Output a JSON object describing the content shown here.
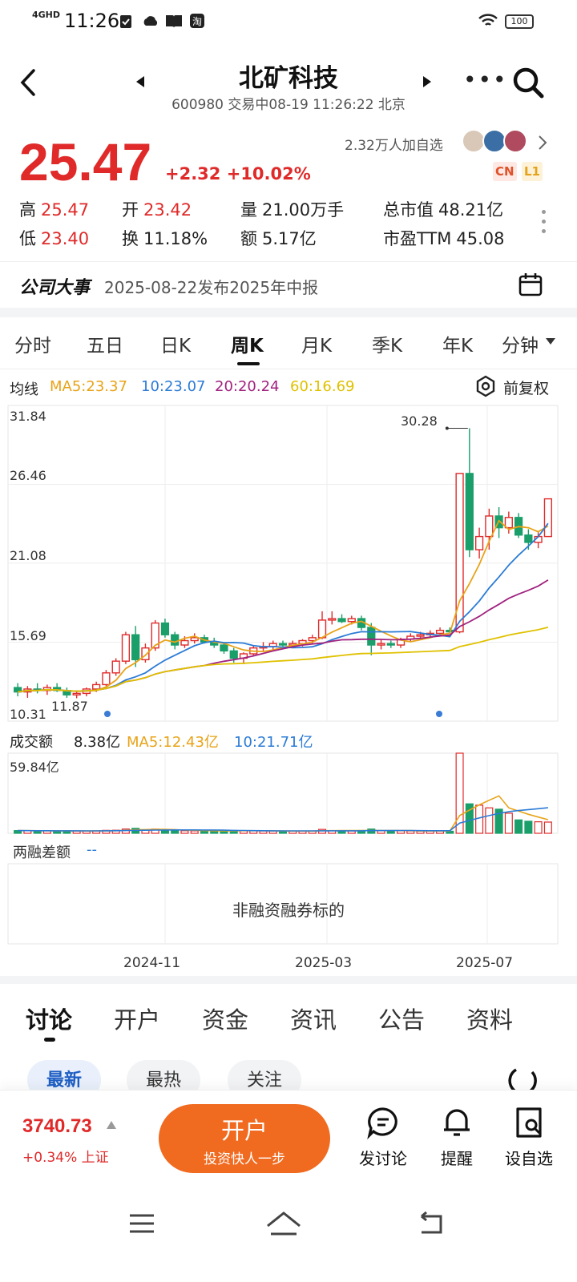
{
  "status_bar": {
    "time": "11:26",
    "network": "4GHD",
    "battery": "100"
  },
  "header": {
    "title": "北矿科技",
    "subtitle": "600980 交易中08-19 11:26:22 北京"
  },
  "quote": {
    "price": "25.47",
    "change": "+2.32 +10.02%",
    "watchers": "2.32万人加自选",
    "badges": [
      "CN",
      "L1"
    ]
  },
  "stats": [
    {
      "label": "高",
      "value": "25.47",
      "color": "red"
    },
    {
      "label": "开",
      "value": "23.42",
      "color": "red"
    },
    {
      "label": "量",
      "value": "21.00万手",
      "color": "plain"
    },
    {
      "label": "总市值",
      "value": "48.21亿",
      "color": "plain"
    },
    {
      "label": "低",
      "value": "23.40",
      "color": "red"
    },
    {
      "label": "换",
      "value": "11.18%",
      "color": "plain"
    },
    {
      "label": "额",
      "value": "5.17亿",
      "color": "plain"
    },
    {
      "label": "市盈TTM",
      "value": "45.08",
      "color": "plain"
    }
  ],
  "events": {
    "label": "公司大事",
    "text": "2025-08-22发布2025年中报"
  },
  "period_tabs": [
    "分时",
    "五日",
    "日K",
    "周K",
    "月K",
    "季K",
    "年K",
    "分钟"
  ],
  "active_period": "周K",
  "ma_legend": {
    "label": "均线",
    "items": [
      {
        "text": "MA5:23.37",
        "color": "#e8a317"
      },
      {
        "text": "10:23.07",
        "color": "#2b7bd6"
      },
      {
        "text": "20:20.24",
        "color": "#a0227f"
      },
      {
        "text": "60:16.69",
        "color": "#e0c100"
      }
    ],
    "adjust": "前复权"
  },
  "price_axis": [
    "31.84",
    "26.46",
    "21.08",
    "15.69",
    "10.31"
  ],
  "annotations": {
    "high": "30.28",
    "low": "11.87"
  },
  "volume": {
    "label": "成交额",
    "current": "8.38亿",
    "ma5": "MA5:12.43亿",
    "ma10": "10:21.71亿",
    "axis_max": "59.84亿"
  },
  "margin": {
    "label": "两融差额",
    "value": "--",
    "note": "非融资融券标的"
  },
  "date_axis": [
    "2024-11",
    "2025-03",
    "2025-07"
  ],
  "colors": {
    "up": "#e02a2a",
    "down": "#1a9e6a",
    "accent": "#f06a1f"
  },
  "chart_data": {
    "type": "candlestick",
    "period": "weekly",
    "ylim": [
      10.31,
      31.84
    ],
    "x": [
      "2024-07 wk1",
      "wk2",
      "wk3",
      "wk4",
      "wk5",
      "wk6",
      "wk7",
      "wk8",
      "wk9",
      "wk10",
      "wk11",
      "wk12",
      "wk13",
      "2024-11 wk1",
      "wk2",
      "wk3",
      "wk4",
      "wk5",
      "wk6",
      "wk7",
      "wk8",
      "wk9",
      "wk10",
      "wk11",
      "wk12",
      "wk13",
      "wk14",
      "wk15",
      "wk16",
      "wk17",
      "wk18",
      "wk19",
      "wk20",
      "wk21",
      "wk22",
      "2025-03 wk1",
      "wk2",
      "wk3",
      "wk4",
      "wk5",
      "wk6",
      "wk7",
      "wk8",
      "wk9",
      "wk10",
      "wk11",
      "wk12",
      "wk13",
      "wk14",
      "wk15",
      "wk16",
      "wk17",
      "wk18",
      "wk19",
      "wk20",
      "2025-07 wk1",
      "wk2",
      "wk3",
      "wk4",
      "wk5",
      "wk6",
      "wk7",
      "wk8"
    ],
    "ohlc": [
      [
        12.6,
        12.9,
        12.0,
        12.3
      ],
      [
        12.3,
        12.7,
        11.9,
        12.5
      ],
      [
        12.5,
        12.9,
        12.2,
        12.4
      ],
      [
        12.4,
        12.8,
        12.1,
        12.6
      ],
      [
        12.6,
        12.9,
        12.3,
        12.4
      ],
      [
        12.4,
        12.6,
        11.9,
        12.1
      ],
      [
        12.1,
        12.4,
        11.87,
        12.2
      ],
      [
        12.2,
        12.6,
        12.0,
        12.5
      ],
      [
        12.5,
        13.0,
        12.3,
        12.8
      ],
      [
        12.8,
        13.8,
        12.7,
        13.6
      ],
      [
        13.6,
        14.6,
        13.4,
        14.4
      ],
      [
        14.4,
        16.4,
        14.2,
        16.2
      ],
      [
        16.2,
        16.8,
        14.0,
        14.5
      ],
      [
        14.5,
        15.6,
        14.3,
        15.3
      ],
      [
        15.3,
        17.2,
        15.1,
        17.0
      ],
      [
        17.0,
        17.3,
        16.0,
        16.2
      ],
      [
        16.2,
        16.4,
        15.2,
        15.5
      ],
      [
        15.5,
        16.1,
        15.3,
        15.8
      ],
      [
        15.8,
        16.3,
        15.6,
        16.0
      ],
      [
        16.0,
        16.2,
        15.6,
        15.7
      ],
      [
        15.7,
        16.0,
        15.3,
        15.5
      ],
      [
        15.5,
        15.7,
        14.9,
        15.1
      ],
      [
        15.1,
        15.3,
        14.3,
        14.6
      ],
      [
        14.6,
        15.0,
        14.2,
        14.9
      ],
      [
        14.9,
        15.5,
        14.8,
        15.3
      ],
      [
        15.3,
        15.7,
        15.1,
        15.4
      ],
      [
        15.4,
        15.8,
        15.2,
        15.6
      ],
      [
        15.6,
        15.8,
        15.4,
        15.5
      ],
      [
        15.5,
        15.8,
        15.3,
        15.6
      ],
      [
        15.6,
        15.9,
        15.4,
        15.8
      ],
      [
        15.8,
        16.2,
        15.6,
        16.0
      ],
      [
        16.0,
        17.8,
        15.9,
        17.2
      ],
      [
        17.2,
        17.8,
        16.9,
        17.3
      ],
      [
        17.3,
        17.6,
        17.0,
        17.1
      ],
      [
        17.1,
        17.5,
        16.9,
        17.3
      ],
      [
        17.3,
        17.5,
        16.5,
        16.7
      ],
      [
        16.7,
        17.0,
        14.8,
        15.5
      ],
      [
        15.5,
        15.9,
        15.2,
        15.6
      ],
      [
        15.6,
        15.8,
        15.3,
        15.5
      ],
      [
        15.5,
        16.0,
        15.3,
        15.9
      ],
      [
        15.9,
        16.3,
        15.7,
        16.1
      ],
      [
        16.1,
        16.4,
        15.9,
        16.2
      ],
      [
        16.2,
        16.5,
        16.0,
        16.3
      ],
      [
        16.3,
        16.7,
        16.1,
        16.5
      ],
      [
        16.5,
        16.7,
        16.3,
        16.4
      ],
      [
        16.4,
        17.5,
        16.3,
        27.2
      ],
      [
        27.2,
        30.28,
        21.5,
        22.0
      ],
      [
        22.0,
        23.5,
        21.4,
        22.9
      ],
      [
        22.9,
        24.8,
        22.0,
        24.3
      ],
      [
        24.3,
        24.9,
        22.8,
        23.5
      ],
      [
        23.5,
        24.6,
        23.1,
        24.2
      ],
      [
        24.2,
        24.5,
        22.8,
        23.0
      ],
      [
        23.0,
        23.4,
        22.0,
        22.5
      ],
      [
        22.5,
        23.2,
        22.1,
        22.9
      ],
      [
        22.9,
        25.47,
        23.4,
        25.47
      ]
    ],
    "ma": {
      "MA5": 23.37,
      "MA10": 23.07,
      "MA20": 20.24,
      "MA60": 16.69
    },
    "volume_ylim": [
      0,
      59.84
    ],
    "volume_unit": "亿",
    "volume_latest": 8.38
  },
  "bottom_tabs": [
    "讨论",
    "开户",
    "资金",
    "资讯",
    "公告",
    "资料"
  ],
  "active_bottom_tab": "讨论",
  "sort_pills": [
    "最新",
    "最热",
    "关注"
  ],
  "index": {
    "value": "3740.73",
    "change": "+0.34% 上证"
  },
  "open_button": {
    "title": "开户",
    "subtitle": "投资快人一步"
  },
  "actions": [
    {
      "label": "发讨论",
      "icon": "chat-icon"
    },
    {
      "label": "提醒",
      "icon": "bell-icon"
    },
    {
      "label": "设自选",
      "icon": "add-watchlist-icon"
    }
  ]
}
